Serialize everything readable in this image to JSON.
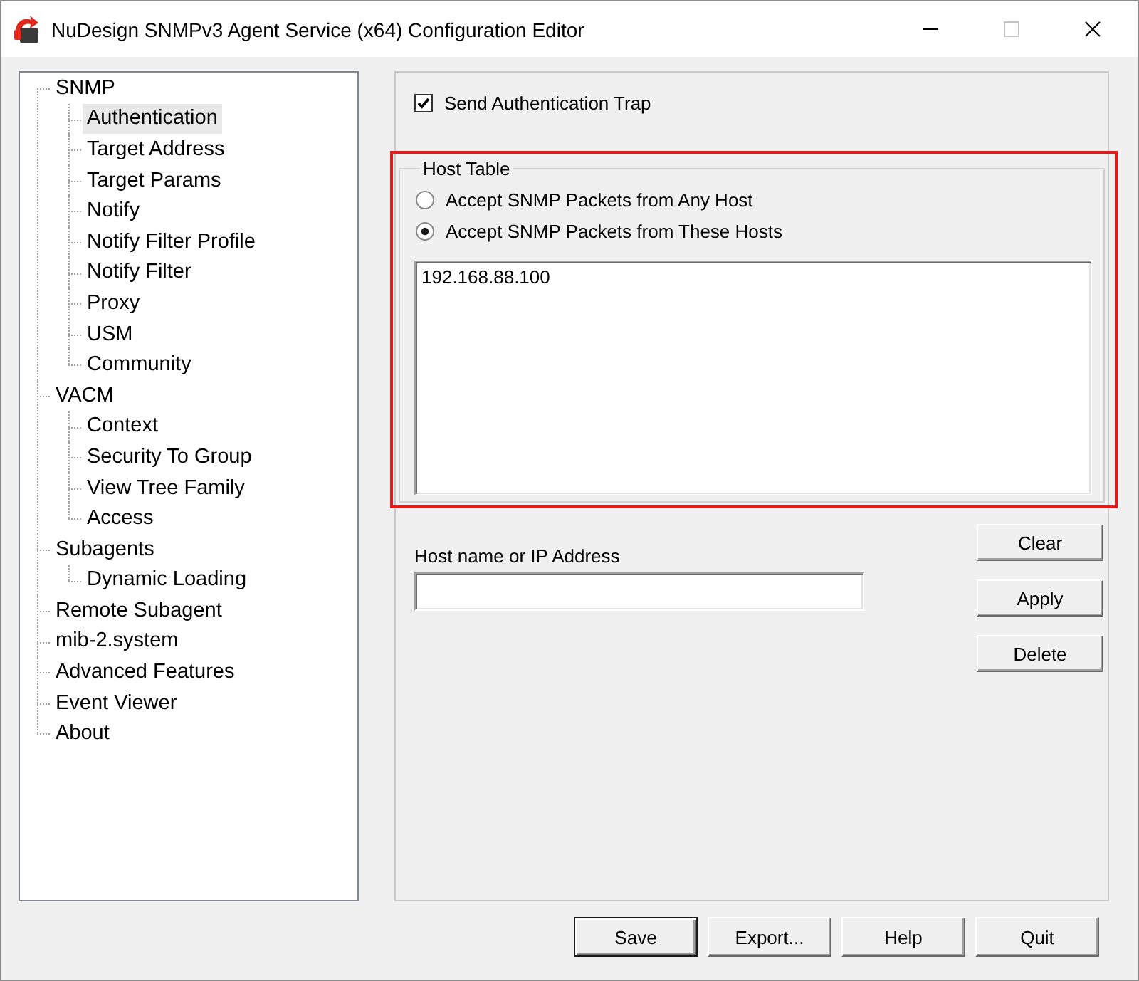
{
  "window": {
    "title": "NuDesign SNMPv3 Agent Service (x64) Configuration Editor",
    "maximize_disabled": true
  },
  "tree": [
    {
      "label": "SNMP",
      "selected": false,
      "children": [
        {
          "label": "Authentication",
          "selected": true
        },
        {
          "label": "Target Address",
          "selected": false
        },
        {
          "label": "Target Params",
          "selected": false
        },
        {
          "label": "Notify",
          "selected": false
        },
        {
          "label": "Notify Filter Profile",
          "selected": false
        },
        {
          "label": "Notify Filter",
          "selected": false
        },
        {
          "label": "Proxy",
          "selected": false
        },
        {
          "label": "USM",
          "selected": false
        },
        {
          "label": "Community",
          "selected": false
        }
      ]
    },
    {
      "label": "VACM",
      "selected": false,
      "children": [
        {
          "label": "Context",
          "selected": false
        },
        {
          "label": "Security To Group",
          "selected": false
        },
        {
          "label": "View Tree Family",
          "selected": false
        },
        {
          "label": "Access",
          "selected": false
        }
      ]
    },
    {
      "label": "Subagents",
      "selected": false,
      "children": [
        {
          "label": "Dynamic Loading",
          "selected": false
        }
      ]
    },
    {
      "label": "Remote Subagent",
      "selected": false
    },
    {
      "label": "mib-2.system",
      "selected": false
    },
    {
      "label": "Advanced Features",
      "selected": false
    },
    {
      "label": "Event Viewer",
      "selected": false
    },
    {
      "label": "About",
      "selected": false
    }
  ],
  "auth_trap": {
    "label": "Send Authentication Trap",
    "checked": true
  },
  "host_table": {
    "title": "Host Table",
    "options": [
      {
        "label": "Accept SNMP Packets from Any Host",
        "selected": false
      },
      {
        "label": "Accept SNMP Packets from These Hosts",
        "selected": true
      }
    ],
    "hosts": [
      "192.168.88.100"
    ]
  },
  "host_field": {
    "label": "Host name or IP Address"
  },
  "side_buttons": [
    "Clear",
    "Apply",
    "Delete"
  ],
  "footer_buttons": [
    {
      "label": "Save",
      "default": true
    },
    {
      "label": "Export...",
      "default": false
    },
    {
      "label": "Help",
      "default": false
    },
    {
      "label": "Quit",
      "default": false
    }
  ]
}
